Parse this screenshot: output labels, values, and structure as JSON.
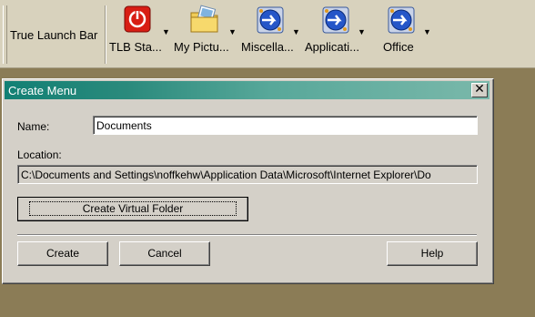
{
  "toolbar": {
    "title": "True Launch Bar",
    "buttons": [
      {
        "label": "TLB Sta...",
        "icon": "power-icon"
      },
      {
        "label": "My Pictu...",
        "icon": "pictures-folder-icon"
      },
      {
        "label": "Miscella...",
        "icon": "launch-icon"
      },
      {
        "label": "Applicati...",
        "icon": "launch-icon"
      },
      {
        "label": "Office",
        "icon": "launch-icon"
      }
    ],
    "dropdown_glyph": "▼"
  },
  "dialog": {
    "title": "Create Menu",
    "close_glyph": "✕",
    "name_label": "Name:",
    "name_value": "Documents",
    "location_label": "Location:",
    "location_value": "C:\\Documents and Settings\\noffkehw\\Application Data\\Microsoft\\Internet Explorer\\Do",
    "create_virtual_folder_label": "Create Virtual Folder",
    "create_label": "Create",
    "cancel_label": "Cancel",
    "help_label": "Help"
  }
}
